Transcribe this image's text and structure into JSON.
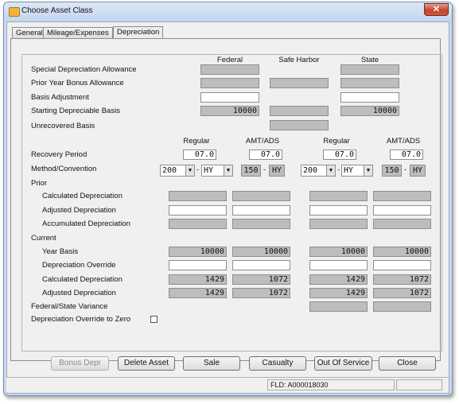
{
  "window": {
    "title": "Choose Asset Class",
    "close_glyph": "✕"
  },
  "tabs": [
    {
      "label": "General"
    },
    {
      "label": "Mileage/Expenses"
    },
    {
      "label": "Depreciation"
    }
  ],
  "headers": {
    "federal": "Federal",
    "safe_harbor": "Safe Harbor",
    "state": "State",
    "regular": "Regular",
    "amt_ads": "AMT/ADS"
  },
  "labels": {
    "special_depr": "Special Depreciation Allowance",
    "prior_bonus": "Prior Year Bonus Allowance",
    "basis_adj": "Basis Adjustment",
    "starting_basis": "Starting Depreciable Basis",
    "unrecovered": "Unrecovered Basis",
    "recovery_period": "Recovery Period",
    "method_convention": "Method/Convention",
    "prior": "Prior",
    "calc_depr": "Calculated Depreciation",
    "adj_depr": "Adjusted Depreciation",
    "accum_depr": "Accumulated Depreciation",
    "current": "Current",
    "year_basis": "Year Basis",
    "depr_override": "Depreciation Override",
    "calc_depr2": "Calculated Depreciation",
    "adj_depr2": "Adjusted Depreciation",
    "variance": "Federal/State Variance",
    "override_zero": "Depreciation Override to Zero"
  },
  "values": {
    "starting_basis_federal": "10000",
    "starting_basis_state": "10000",
    "recovery": {
      "fed_regular": "07.0",
      "fed_amt": "07.0",
      "state_regular": "07.0",
      "state_amt": "07.0"
    },
    "method": {
      "fed_regular": {
        "method": "200",
        "convention": "HY"
      },
      "fed_amt": {
        "method": "150",
        "convention": "HY"
      },
      "state_regular": {
        "method": "200",
        "convention": "HY"
      },
      "state_amt": {
        "method": "150",
        "convention": "HY"
      }
    },
    "year_basis": {
      "fed_regular": "10000",
      "fed_amt": "10000",
      "state_regular": "10000",
      "state_amt": "10000"
    },
    "calc_depr": {
      "fed_regular": "1429",
      "fed_amt": "1072",
      "state_regular": "1429",
      "state_amt": "1072"
    },
    "adj_depr": {
      "fed_regular": "1429",
      "fed_amt": "1072",
      "state_regular": "1429",
      "state_amt": "1072"
    },
    "override_zero_checked": false
  },
  "dropdown_arrow": "▼",
  "dash": "-",
  "buttons": {
    "bonus": "Bonus Depr",
    "delete": "Delete Asset",
    "sale": "Sale",
    "casualty": "Casualty",
    "out_of_service": "Out Of Service",
    "close": "Close"
  },
  "status": {
    "field": "FLD: A000018030"
  }
}
